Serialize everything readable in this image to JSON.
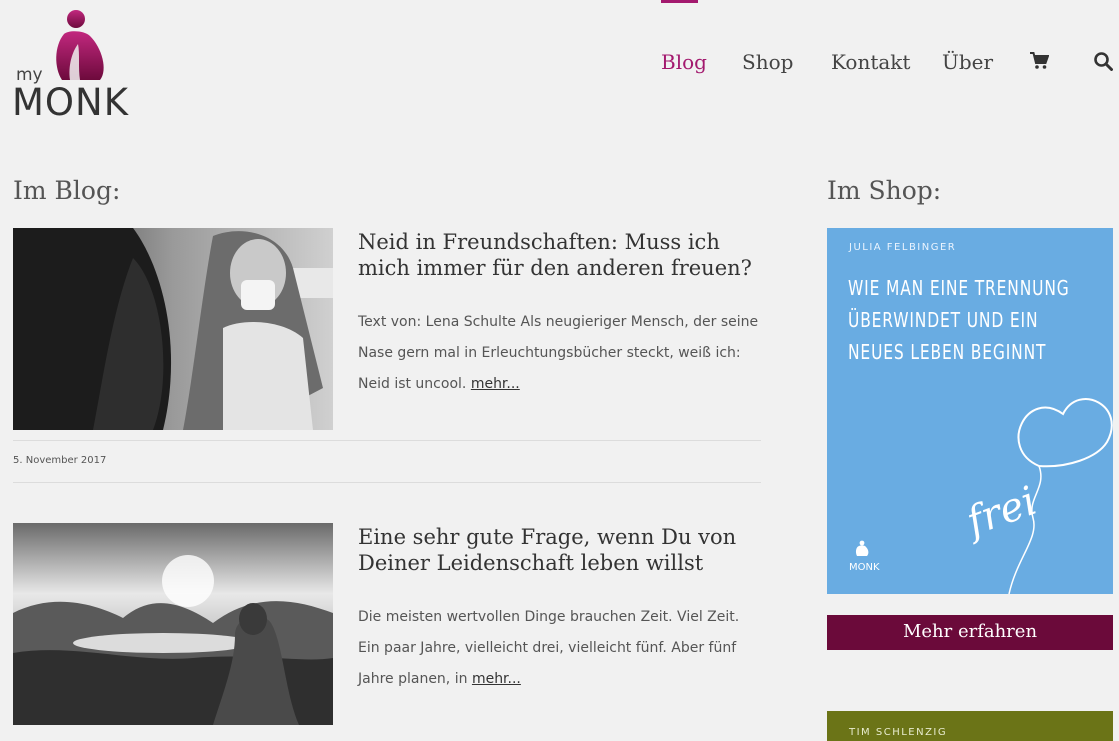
{
  "brand": {
    "my": "my",
    "name": "MONK"
  },
  "nav": {
    "items": [
      {
        "label": "Blog",
        "active": true
      },
      {
        "label": "Shop",
        "active": false
      },
      {
        "label": "Kontakt",
        "active": false
      },
      {
        "label": "Über",
        "active": false
      }
    ],
    "cart_icon": "shopping-cart-icon",
    "search_icon": "search-icon"
  },
  "blog": {
    "title": "Im Blog:",
    "posts": [
      {
        "title": "Neid in Freundschaften: Muss ich mich immer für den anderen freuen?",
        "excerpt": "Text von: Lena Schulte Als neugieriger Mensch, der seine Nase gern mal in Erleuchtungsbücher steckt, weiß ich: Neid ist uncool.",
        "more": "mehr...",
        "date": "5. November 2017"
      },
      {
        "title": "Eine sehr gute Frage, wenn Du von Deiner Leidenschaft leben willst",
        "excerpt": "Die meisten wertvollen Dinge brauchen Zeit. Viel Zeit. Ein paar Jahre, vielleicht drei, vielleicht fünf. Aber fünf Jahre planen, in",
        "more": "mehr..."
      }
    ]
  },
  "shop": {
    "title": "Im Shop:",
    "book1": {
      "author": "JULIA FELBINGER",
      "title_lines": [
        "WIE MAN EINE TRENNUNG",
        "ÜBERWINDET UND EIN",
        "NEUES LEBEN BEGINNT"
      ],
      "script_word": "frei",
      "publisher": "MONK",
      "color": "#69ace2"
    },
    "cta": "Mehr erfahren",
    "book2": {
      "author": "TIM SCHLENZIG",
      "color": "#6b7417"
    }
  },
  "colors": {
    "accent": "#a3196e",
    "cta": "#6b0a3a"
  }
}
